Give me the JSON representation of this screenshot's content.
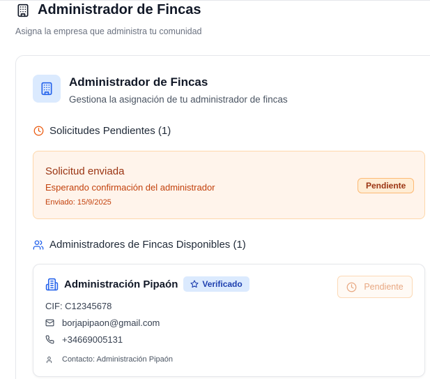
{
  "header": {
    "title": "Administrador de Fincas",
    "subtitle": "Asigna la empresa que administra tu comunidad",
    "icon": "building-icon"
  },
  "card": {
    "title": "Administrador de Fincas",
    "description": "Gestiona la asignación de tu administrador de fincas",
    "icon": "building-icon"
  },
  "pending_section": {
    "label": "Solicitudes Pendientes (1)",
    "icon": "clock-icon",
    "request": {
      "title": "Solicitud enviada",
      "message": "Esperando confirmación del administrador",
      "date": "Enviado: 15/9/2025",
      "badge": "Pendiente"
    }
  },
  "available_section": {
    "label": "Administradores de Fincas Disponibles (1)",
    "icon": "users-icon",
    "admins": [
      {
        "name": "Administración Pipaón",
        "verified_label": "Verificado",
        "cif": "CIF: C12345678",
        "email": "borjapipaon@gmail.com",
        "phone": "+34669005131",
        "contact": "Contacto: Administración Pipaón",
        "status_button": "Pendiente"
      }
    ]
  },
  "colors": {
    "accent_blue": "#2563eb",
    "pending_orange": "#c2410c",
    "pending_bg": "#fff4eb"
  }
}
